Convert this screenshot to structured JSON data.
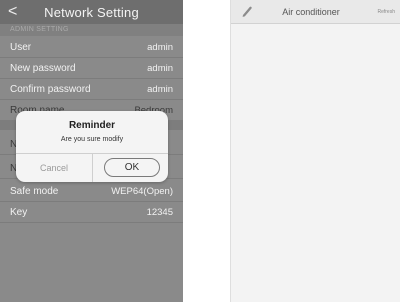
{
  "network_setting": {
    "nav": {
      "back_glyph": "<",
      "title": "Network Setting"
    },
    "section_header": "ADMIN SETTING",
    "rows": [
      {
        "label": "User",
        "value": "admin"
      },
      {
        "label": "New password",
        "value": "admin"
      },
      {
        "label": "Confirm password",
        "value": "admin"
      },
      {
        "label": "Room name",
        "value": "Bedroom"
      },
      {
        "label": "N",
        "value": ""
      },
      {
        "label": "N",
        "value": ""
      },
      {
        "label": "Safe mode",
        "value": "WEP64(Open)"
      },
      {
        "label": "Key",
        "value": "12345"
      }
    ],
    "dialog": {
      "title": "Reminder",
      "message": "Are you sure modify",
      "cancel_label": "Cancel",
      "ok_label": "OK"
    }
  },
  "air_conditioner": {
    "nav": {
      "icon": "pencil-icon",
      "title": "Air conditioner",
      "refresh_label": "Refresh"
    }
  },
  "colors": {
    "left_bg": "#8a8a8a",
    "left_nav": "#6e6e6e",
    "dialog_bg": "#f4f4f4",
    "right_bg": "#f3f3f3"
  }
}
